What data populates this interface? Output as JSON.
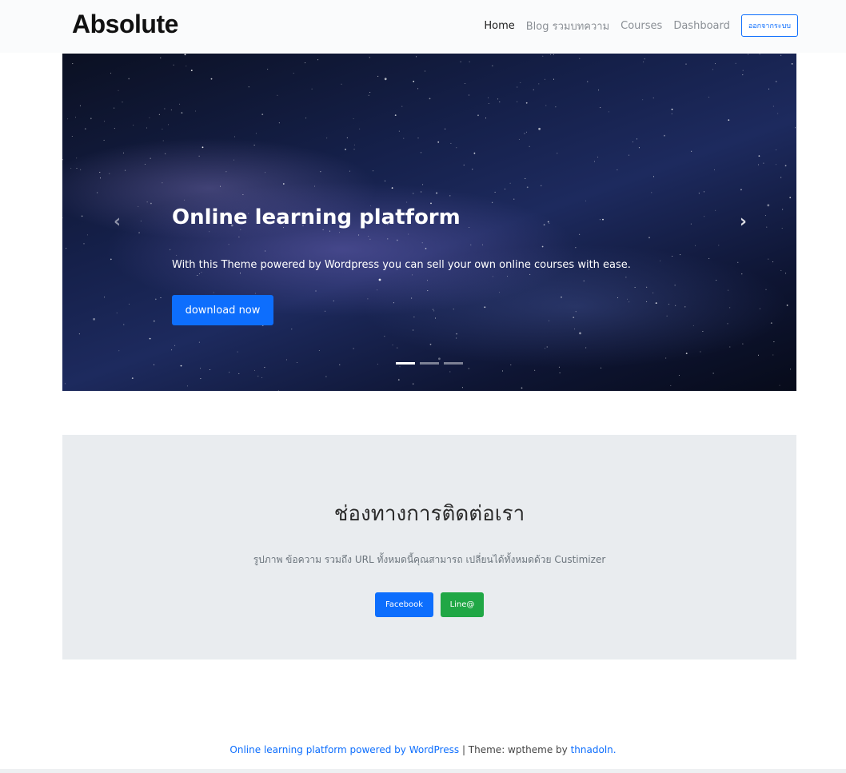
{
  "header": {
    "brand": "Absolute",
    "nav": {
      "home": "Home",
      "blog": "Blog รวมบทความ",
      "courses": "Courses",
      "dashboard": "Dashboard",
      "signout": "ออกจากระบบ"
    }
  },
  "hero": {
    "title": "Online learning platform",
    "subtitle": "With this Theme powered by Wordpress you can sell your own online courses with ease.",
    "button_label": "download now",
    "prev_icon": "chevron-left-icon",
    "next_icon": "chevron-right-icon",
    "slides_count": 3,
    "active_slide": 1
  },
  "contact": {
    "title": "ช่องทางการติดต่อเรา",
    "subtitle": "รูปภาพ ข้อความ รวมถึง URL ทั้งหมดนี้คุณสามารถ เปลี่ยนได้ทั้งหมดด้วย Custimizer",
    "facebook_label": "Facebook",
    "line_label": "Line@"
  },
  "footer": {
    "site_link": "Online learning platform powered by WordPress",
    "separator": " | Theme: wptheme by ",
    "author_link": "thnadoln."
  },
  "colors": {
    "primary": "#0d6efd",
    "line_green": "#20a745",
    "contact_bg": "#e9ecef"
  }
}
